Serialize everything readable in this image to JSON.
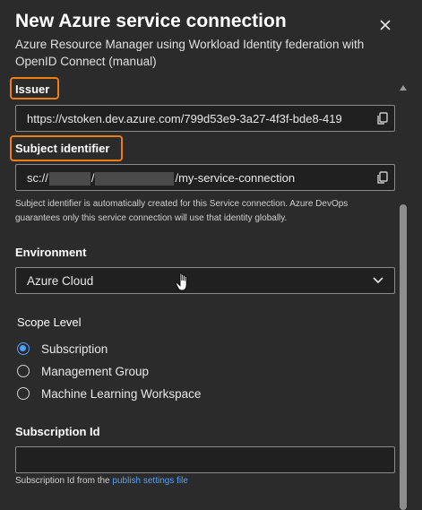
{
  "header": {
    "title": "New Azure service connection",
    "subtitle": "Azure Resource Manager using Workload Identity federation with OpenID Connect (manual)"
  },
  "issuer": {
    "label": "Issuer",
    "value": "https://vstoken.dev.azure.com/799d53e9-3a27-4f3f-bde8-419"
  },
  "subject": {
    "label": "Subject identifier",
    "prefix": "sc://",
    "separator": "/",
    "suffix": "/my-service-connection",
    "help": "Subject identifier is automatically created for this Service connection. Azure DevOps guarantees only this service connection will use that identity globally."
  },
  "environment": {
    "label": "Environment",
    "selected": "Azure Cloud"
  },
  "scope": {
    "label": "Scope Level",
    "options": [
      "Subscription",
      "Management Group",
      "Machine Learning Workspace"
    ],
    "selected": "Subscription"
  },
  "subscription": {
    "label": "Subscription Id",
    "value": "",
    "help_prefix": "Subscription Id from the ",
    "help_link": "publish settings file"
  },
  "colors": {
    "accent": "#4ea1ff",
    "highlight": "#f07d12",
    "background": "#2b2b2b"
  },
  "icons": [
    "close-icon",
    "copy-icon",
    "chevron-down-icon",
    "mouse-cursor-icon"
  ]
}
